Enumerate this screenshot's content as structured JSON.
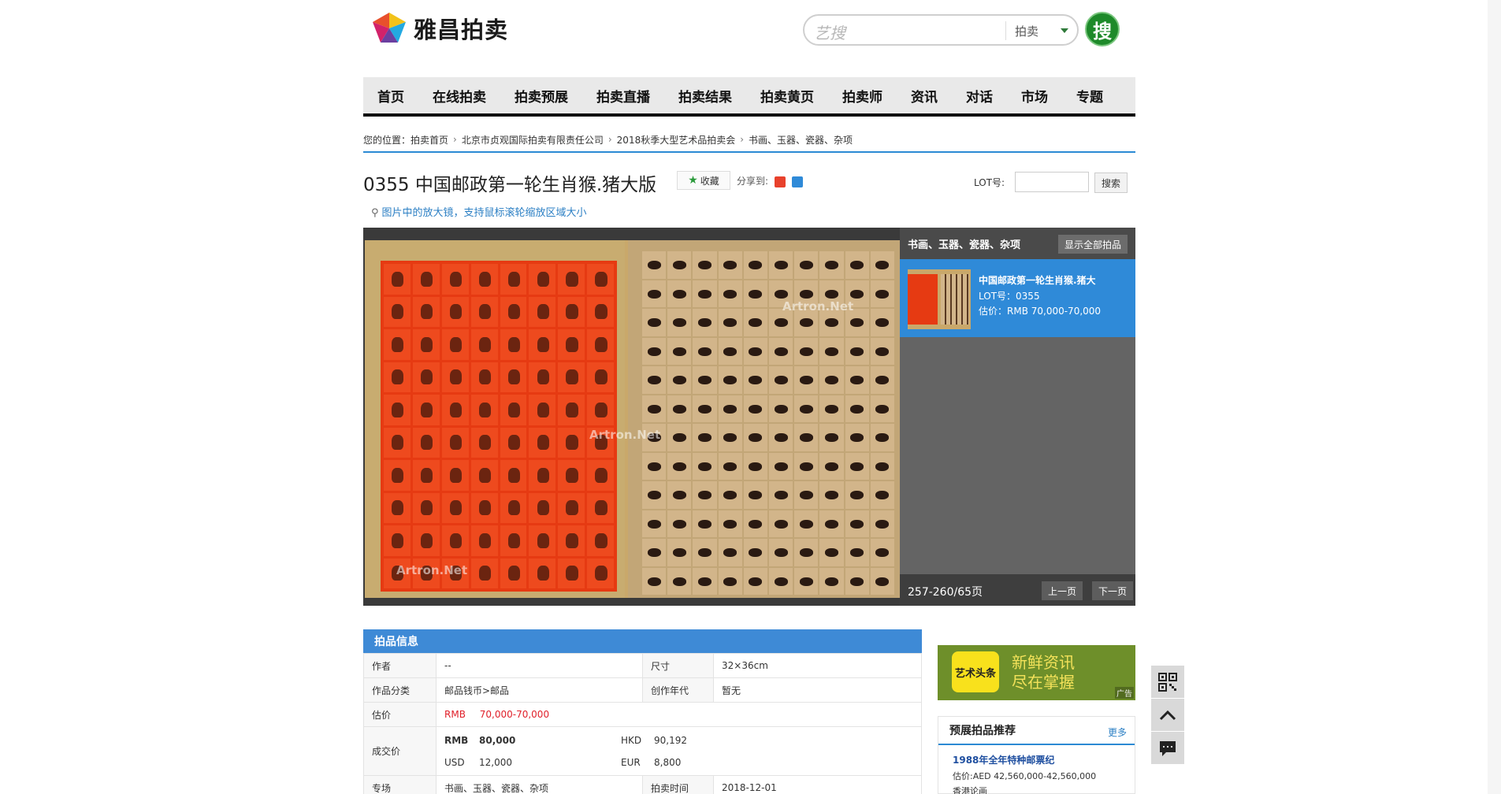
{
  "header": {
    "logo_text": "雅昌拍卖",
    "search_brand": "艺搜",
    "search_placeholder": "",
    "search_scope": "拍卖",
    "search_button": "搜"
  },
  "nav": [
    "首页",
    "在线拍卖",
    "拍卖预展",
    "拍卖直播",
    "拍卖结果",
    "拍卖黄页",
    "拍卖师",
    "资讯",
    "对话",
    "市场",
    "专题"
  ],
  "breadcrumb": {
    "label": "您的位置：",
    "items": [
      "拍卖首页",
      "北京市贞观国际拍卖有限责任公司",
      "2018秋季大型艺术品拍卖会",
      "书画、玉器、瓷器、杂项"
    ]
  },
  "lot": {
    "title": "0355 中国邮政第一轮生肖猴.猪大版",
    "favorite": "收藏",
    "share_label": "分享到:",
    "lot_no_label": "LOT号:",
    "lot_search_button": "搜索",
    "magnifier_tip": "图片中的放大镜，支持鼠标滚轮缩放区域大小"
  },
  "gallery": {
    "watermark": "Artron.Net",
    "side_title": "书画、玉器、瓷器、杂项",
    "show_all": "显示全部拍品",
    "current_item": {
      "name": "中国邮政第一轮生肖猴.猪大",
      "lot": "LOT号：0355",
      "estimate": "估价：RMB 70,000-70,000"
    },
    "pager_text": "257-260/65页",
    "prev": "上一页",
    "next": "下一页"
  },
  "info": {
    "heading": "拍品信息",
    "rows": {
      "author_label": "作者",
      "author": "--",
      "size_label": "尺寸",
      "size": "32×36cm",
      "category_label": "作品分类",
      "category": "邮品钱币>邮品",
      "year_label": "创作年代",
      "year": "暂无",
      "estimate_label": "估价",
      "estimate_currency": "RMB",
      "estimate": "70,000-70,000",
      "sold_label": "成交价",
      "sold_rmb_cur": "RMB",
      "sold_rmb": "80,000",
      "sold_hkd_cur": "HKD",
      "sold_hkd": "90,192",
      "sold_usd_cur": "USD",
      "sold_usd": "12,000",
      "sold_eur_cur": "EUR",
      "sold_eur": "8,800",
      "session_label": "专场",
      "session": "书画、玉器、瓷器、杂项",
      "date_label": "拍卖时间",
      "date": "2018-12-01"
    }
  },
  "ad": {
    "icon_text": "艺术头条",
    "line1": "新鲜资讯",
    "line2": "尽在掌握",
    "tag": "广告"
  },
  "recommend": {
    "heading": "预展拍品推荐",
    "more": "更多",
    "item_title": "1988年全年特种邮票纪",
    "item_estimate": "估价:AED 42,560,000-42,560,000",
    "item_place": "香港论画"
  },
  "colors": {
    "accent_blue": "#3e8ad6",
    "price_red": "#e0202a",
    "search_green": "#1e8a2a"
  }
}
